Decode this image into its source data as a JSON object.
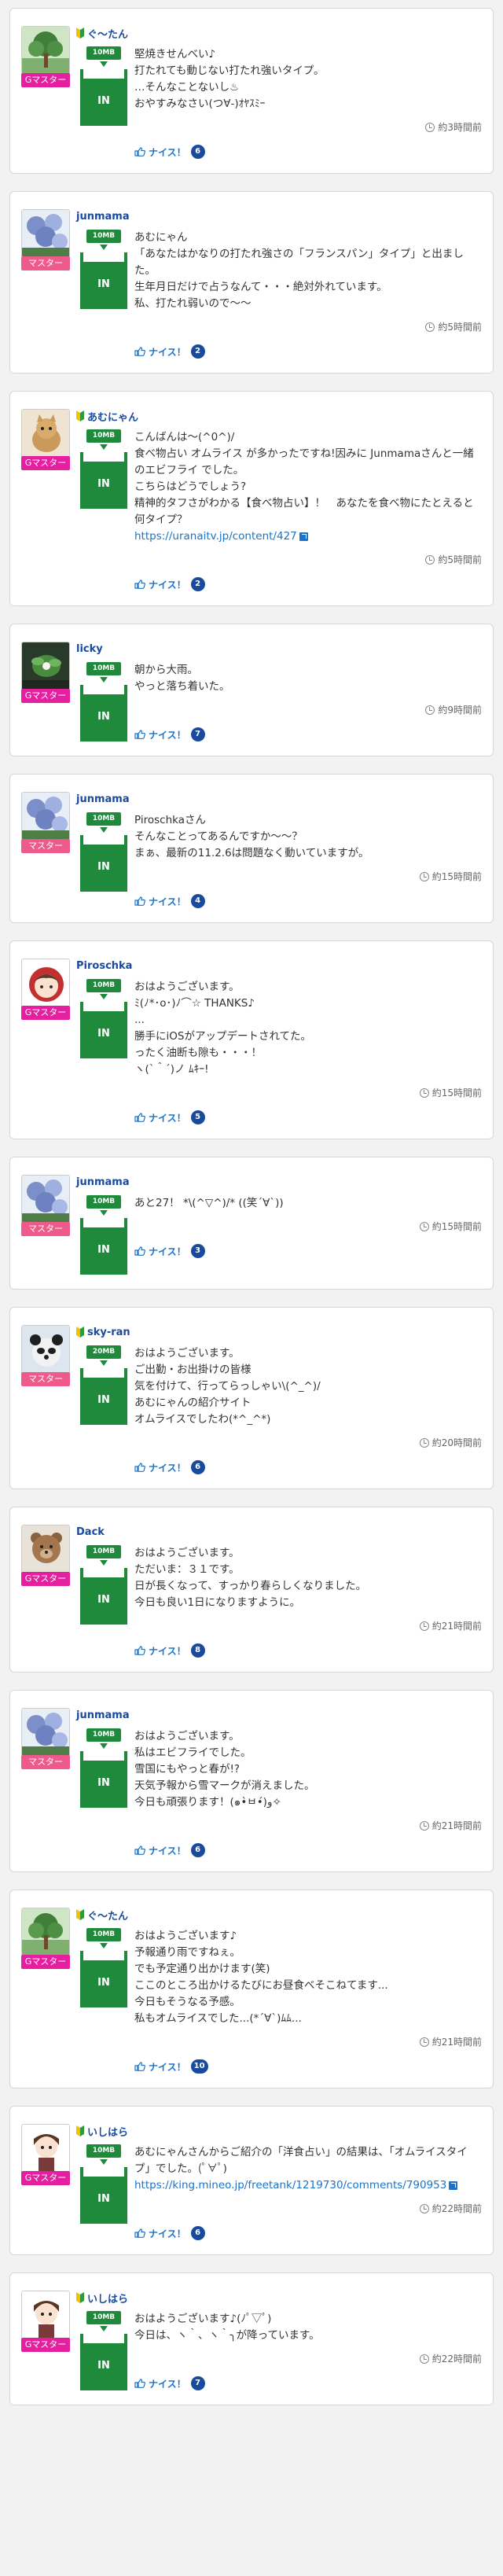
{
  "accent": "#1f8a3c",
  "posts": [
    {
      "name": "ぐ〜たん",
      "beginner": true,
      "role": "Gマスター",
      "role_type": "gmaster",
      "avatar": "tree",
      "capacity": "10MB",
      "box": "IN",
      "lines": [
        "堅焼きせんべい♪",
        "打たれても動じない打たれ強いタイプ。",
        "…そんなことないし♨",
        "おやすみなさい(つ∀-)ｵﾔｽﾐｰ"
      ],
      "link": "",
      "time": "約3時間前",
      "nice_label": "ナイス！",
      "nice_count": "6"
    },
    {
      "name": "junmama",
      "beginner": false,
      "role": "マスター",
      "role_type": "master",
      "avatar": "flowers",
      "capacity": "10MB",
      "box": "IN",
      "lines": [
        "あむにゃん",
        "「あなたはかなりの打たれ強さの「フランスパン」タイプ」と出ました。",
        "生年月日だけで占うなんて・・・絶対外れています。",
        "私、打たれ弱いので〜〜"
      ],
      "link": "",
      "time": "約5時間前",
      "nice_label": "ナイス！",
      "nice_count": "2"
    },
    {
      "name": "あむにゃん",
      "beginner": true,
      "role": "Gマスター",
      "role_type": "gmaster",
      "avatar": "cat",
      "capacity": "10MB",
      "box": "IN",
      "lines": [
        "こんばんは〜(^0^)/",
        "食べ物占い オムライス が多かったですね!因みに Junmamaさんと一緒のエビフライ でした。",
        "こちらはどうでしょう?",
        "精神的タフさがわかる【食べ物占い】！　あなたを食べ物にたとえると何タイプ？"
      ],
      "link": "https://uranaitv.jp/content/427",
      "time": "約5時間前",
      "nice_label": "ナイス！",
      "nice_count": "2"
    },
    {
      "name": "licky",
      "beginner": false,
      "role": "Gマスター",
      "role_type": "gmaster",
      "avatar": "plant",
      "capacity": "10MB",
      "box": "IN",
      "lines": [
        "朝から大雨。",
        "やっと落ち着いた。"
      ],
      "link": "",
      "time": "約9時間前",
      "nice_label": "ナイス！",
      "nice_count": "7"
    },
    {
      "name": "junmama",
      "beginner": false,
      "role": "マスター",
      "role_type": "master",
      "avatar": "flowers",
      "capacity": "10MB",
      "box": "IN",
      "lines": [
        "Piroschkaさん",
        "そんなことってあるんですか〜〜？",
        "まぁ、最新の11.2.6は問題なく動いていますが。"
      ],
      "link": "",
      "time": "約15時間前",
      "nice_label": "ナイス！",
      "nice_count": "4"
    },
    {
      "name": "Piroschka",
      "beginner": false,
      "role": "Gマスター",
      "role_type": "gmaster",
      "avatar": "girl",
      "capacity": "10MB",
      "box": "IN",
      "lines": [
        "おはようございます。",
        "ﾐ(ﾉ*･o･)ﾉ⌒☆ THANKS♪",
        "...",
        "勝手にiOSがアップデートされてた。",
        "ったく油断も隙も・・・！",
        "ヽ(`＾´)ノ ﾑｷｰ!"
      ],
      "link": "",
      "time": "約15時間前",
      "nice_label": "ナイス！",
      "nice_count": "5"
    },
    {
      "name": "junmama",
      "beginner": false,
      "role": "マスター",
      "role_type": "master",
      "avatar": "flowers",
      "capacity": "10MB",
      "box": "IN",
      "lines": [
        "あと27！ *\\(^▽^)/* ((笑´∀`))"
      ],
      "link": "",
      "time": "約15時間前",
      "nice_label": "ナイス！",
      "nice_count": "3"
    },
    {
      "name": "sky-ran",
      "beginner": true,
      "role": "マスター",
      "role_type": "master",
      "avatar": "bear",
      "capacity": "20MB",
      "box": "IN",
      "lines": [
        "おはようございます。",
        "ご出勤・お出掛けの皆様",
        "気を付けて、行ってらっしゃい\\(^_^)/",
        "あむにゃんの紹介サイト",
        "オムライスでしたわ(*^_^*)"
      ],
      "link": "",
      "time": "約20時間前",
      "nice_label": "ナイス！",
      "nice_count": "6"
    },
    {
      "name": "Dack",
      "beginner": false,
      "role": "Gマスター",
      "role_type": "gmaster",
      "avatar": "teddy",
      "capacity": "10MB",
      "box": "IN",
      "lines": [
        "おはようございます。",
        "ただいま：３１です。",
        "日が長くなって、すっかり春らしくなりました。",
        "今日も良い1日になりますように。"
      ],
      "link": "",
      "time": "約21時間前",
      "nice_label": "ナイス！",
      "nice_count": "8"
    },
    {
      "name": "junmama",
      "beginner": false,
      "role": "マスター",
      "role_type": "master",
      "avatar": "flowers",
      "capacity": "10MB",
      "box": "IN",
      "lines": [
        "おはようございます。",
        "私はエビフライでした。",
        "雪国にもやっと春が!?",
        "天気予報から雪マークが消えました。",
        "今日も頑張ります！(๑•̀ㅂ•́)و✧"
      ],
      "link": "",
      "time": "約21時間前",
      "nice_label": "ナイス！",
      "nice_count": "6"
    },
    {
      "name": "ぐ〜たん",
      "beginner": true,
      "role": "Gマスター",
      "role_type": "gmaster",
      "avatar": "tree",
      "capacity": "10MB",
      "box": "IN",
      "lines": [
        "おはようございます♪",
        "予報通り雨ですねぇ。",
        "でも予定通り出かけます(笑)",
        "ここのところ出かけるたびにお昼食べそこねてます...",
        "今日もそうなる予感。",
        "私もオムライスでした...(*´∀`)ﾑﾑ..."
      ],
      "link": "",
      "time": "約21時間前",
      "nice_label": "ナイス！",
      "nice_count": "10"
    },
    {
      "name": "いしはら",
      "beginner": true,
      "role": "Gマスター",
      "role_type": "gmaster",
      "avatar": "anime",
      "capacity": "10MB",
      "box": "IN",
      "lines": [
        "あむにゃんさんからご紹介の「洋食占い」の結果は、「オムライスタイプ」でした。(ﾟ∀ﾟ)"
      ],
      "link": "https://king.mineo.jp/freetank/1219730/comments/790953",
      "time": "約22時間前",
      "nice_label": "ナイス！",
      "nice_count": "6"
    },
    {
      "name": "いしはら",
      "beginner": true,
      "role": "Gマスター",
      "role_type": "gmaster",
      "avatar": "anime",
      "capacity": "10MB",
      "box": "IN",
      "lines": [
        "おはようございます♪(ﾉﾟ▽ﾟ)",
        "今日は、ヽ｀、ヽ｀╮が降っています。"
      ],
      "link": "",
      "time": "約22時間前",
      "nice_label": "ナイス！",
      "nice_count": "7"
    }
  ]
}
